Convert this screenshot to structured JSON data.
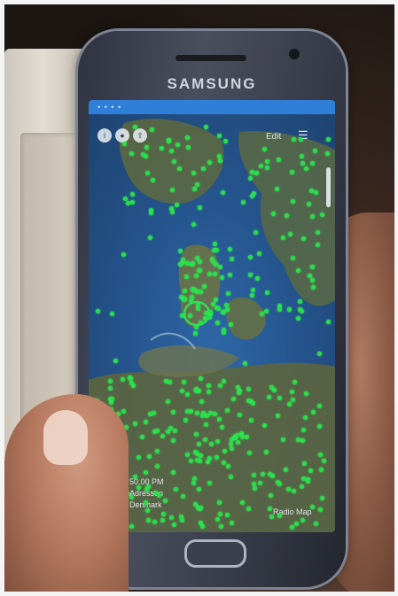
{
  "phone": {
    "brand": "SAMSUNG",
    "status_bar_text": "• • • •"
  },
  "map_app": {
    "top_left_icons": [
      "info-icon",
      "twitter-icon",
      "share-icon"
    ],
    "top_right_label": "Edit",
    "zoom_in_label": "+",
    "zoom_out_label": "−",
    "scale_text": "50.00 PM",
    "place_line_1": "Adressen",
    "place_line_2": "Denmark",
    "bottom_right_label": "Radio Map"
  },
  "colors": {
    "marker_green": "#27e04a",
    "sea_blue": "#2c5a8a",
    "status_bar_blue": "#2f7fd8"
  }
}
